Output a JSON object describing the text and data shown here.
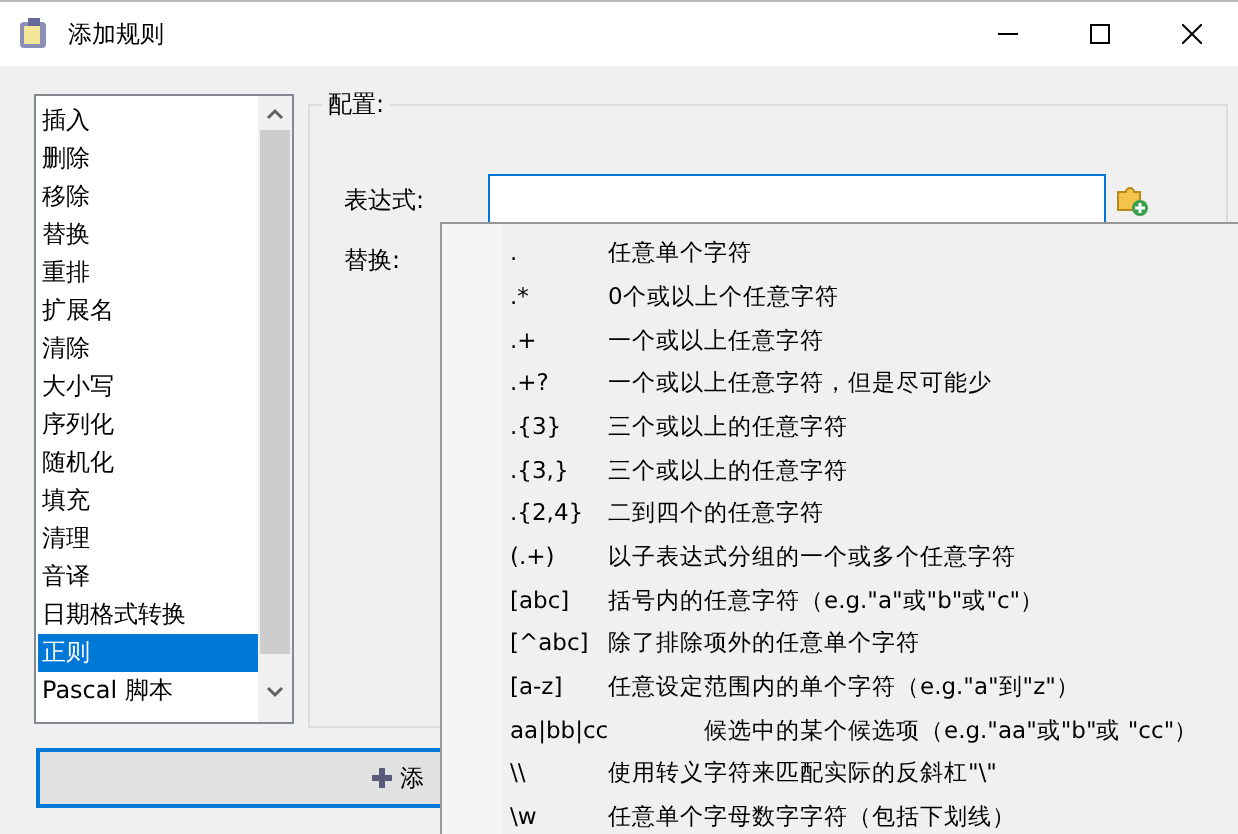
{
  "window": {
    "title": "添加规则"
  },
  "rules_list": {
    "items": [
      {
        "label": "插入",
        "selected": false
      },
      {
        "label": "删除",
        "selected": false
      },
      {
        "label": "移除",
        "selected": false
      },
      {
        "label": "替换",
        "selected": false
      },
      {
        "label": "重排",
        "selected": false
      },
      {
        "label": "扩展名",
        "selected": false
      },
      {
        "label": "清除",
        "selected": false
      },
      {
        "label": "大小写",
        "selected": false
      },
      {
        "label": "序列化",
        "selected": false
      },
      {
        "label": "随机化",
        "selected": false
      },
      {
        "label": "填充",
        "selected": false
      },
      {
        "label": "清理",
        "selected": false
      },
      {
        "label": "音译",
        "selected": false
      },
      {
        "label": "日期格式转换",
        "selected": false
      },
      {
        "label": "正则",
        "selected": true
      },
      {
        "label": "Pascal 脚本",
        "selected": false
      }
    ]
  },
  "config": {
    "title": "配置:",
    "expression_label": "表达式:",
    "replace_label": "替换:"
  },
  "add_button": {
    "label": "添"
  },
  "regex_menu": [
    {
      "pattern": ".",
      "description": "任意单个字符"
    },
    {
      "pattern": ".*",
      "description": "0个或以上个任意字符"
    },
    {
      "pattern": ".+",
      "description": "一个或以上任意字符"
    },
    {
      "pattern": ".+?",
      "description": "一个或以上任意字符，但是尽可能少"
    },
    {
      "pattern": ".{3}",
      "description": "三个或以上的任意字符"
    },
    {
      "pattern": ".{3,}",
      "description": "三个或以上的任意字符"
    },
    {
      "pattern": ".{2,4}",
      "description": "二到四个的任意字符"
    },
    {
      "pattern": "(.+)",
      "description": "以子表达式分组的一个或多个任意字符"
    },
    {
      "pattern": "[abc]",
      "description": "括号内的任意字符（e.g.\"a\"或\"b\"或\"c\"）"
    },
    {
      "pattern": "[^abc]",
      "description": "除了排除项外的任意单个字符"
    },
    {
      "pattern": "[a-z]",
      "description": "任意设定范围内的单个字符（e.g.\"a\"到\"z\"）"
    },
    {
      "pattern": "aa|bb|cc",
      "description": "候选中的某个候选项（e.g.\"aa\"或\"b\"或 \"cc\"）"
    },
    {
      "pattern": "\\\\",
      "description": "使用转义字符来匹配实际的反斜杠\"\\\""
    },
    {
      "pattern": "\\w",
      "description": "任意单个字母数字字符（包括下划线）"
    }
  ]
}
